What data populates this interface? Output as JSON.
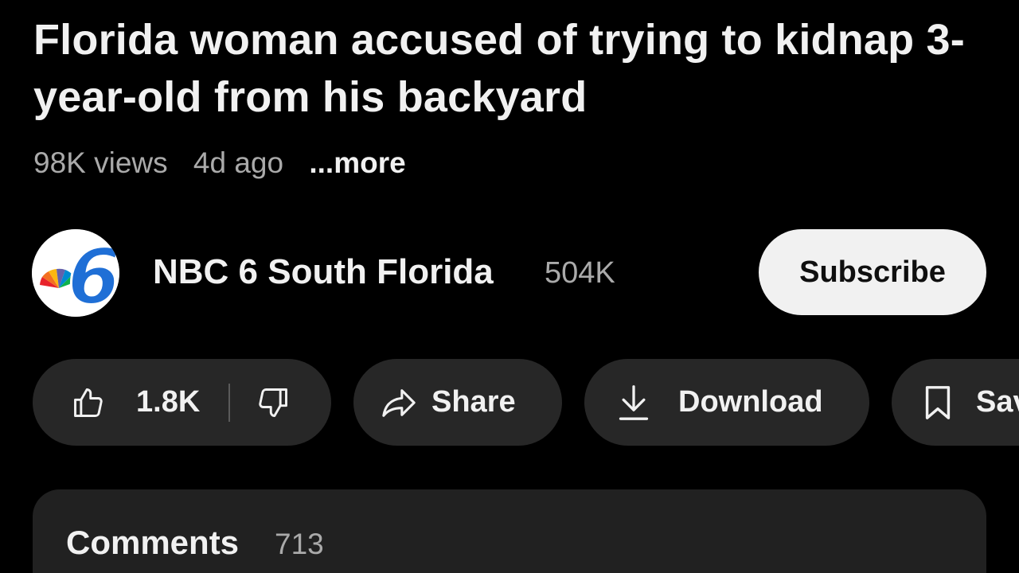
{
  "video": {
    "title": "Florida woman accused of trying to kidnap 3-year-old from his backyard",
    "views": "98K views",
    "age": "4d ago",
    "more_label": "...more"
  },
  "channel": {
    "name": "NBC 6 South Florida",
    "subscribers": "504K",
    "subscribe_label": "Subscribe",
    "avatar_icon": "nbc6-logo-icon"
  },
  "actions": {
    "like_count": "1.8K",
    "share_label": "Share",
    "download_label": "Download",
    "save_label": "Save"
  },
  "comments": {
    "title": "Comments",
    "count": "713"
  },
  "colors": {
    "background": "#000000",
    "pill": "#272727",
    "subscribe_bg": "#f1f1f1",
    "text": "#f1f1f1",
    "secondary_text": "#aaaaaa",
    "comments_bg": "#212121",
    "nbc_blue": "#1f6fd6"
  }
}
